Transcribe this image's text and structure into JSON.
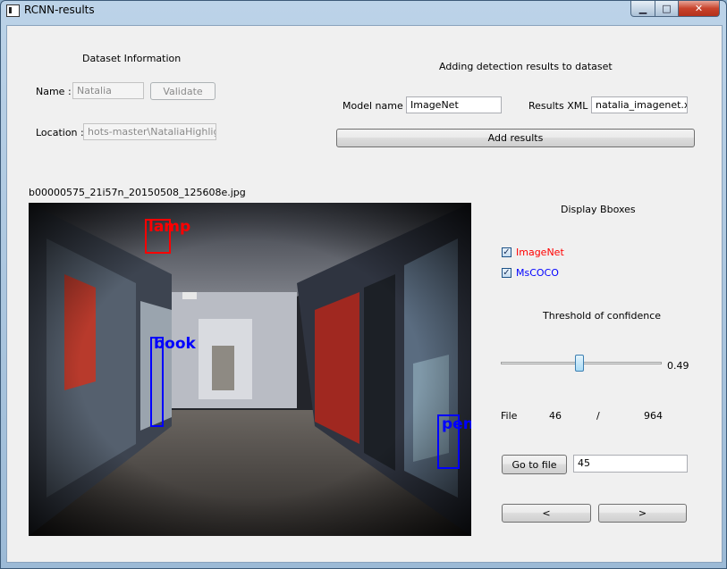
{
  "window": {
    "title": "RCNN-results",
    "minimize": "▁",
    "maximize": "□",
    "close": "✕"
  },
  "dataset": {
    "heading": "Dataset Information",
    "name_label": "Name :",
    "name_value": "Natalia",
    "validate_label": "Validate",
    "location_label": "Location :",
    "location_value": "hots-master\\NataliaHighlights\\"
  },
  "results": {
    "heading": "Adding detection results to dataset",
    "model_label": "Model name :",
    "model_value": "ImageNet",
    "xml_label": "Results XML :",
    "xml_value": "natalia_imagenet.xml",
    "add_label": "Add results"
  },
  "image": {
    "filename": "b00000575_21i57n_20150508_125608e.jpg",
    "boxes": [
      {
        "label": "lamp",
        "color": "#ff0000"
      },
      {
        "label": "book",
        "color": "#0000ff"
      },
      {
        "label": "pen",
        "color": "#0000ff"
      }
    ]
  },
  "display": {
    "heading": "Display Bboxes",
    "imagenet_label": "ImageNet",
    "imagenet_checked": true,
    "imagenet_color": "#ff0000",
    "mscoco_label": "MsCOCO",
    "mscoco_checked": true,
    "mscoco_color": "#0000ff",
    "threshold_label": "Threshold of confidence",
    "threshold_value": "0.49",
    "threshold_fraction": 0.49
  },
  "nav": {
    "file_label": "File",
    "current": "46",
    "separator": "/",
    "total": "964",
    "goto_label": "Go to file",
    "goto_value": "45",
    "prev_label": "<",
    "next_label": ">"
  }
}
